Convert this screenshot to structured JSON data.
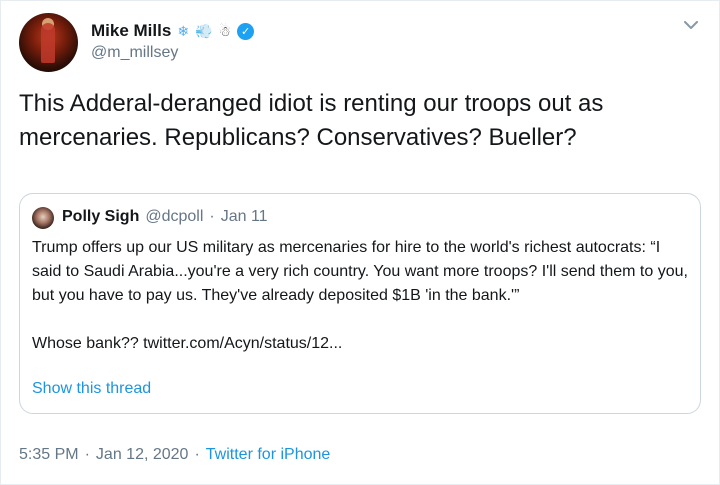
{
  "author": {
    "name": "Mike Mills",
    "name_emojis": [
      "❄",
      "💨",
      "☃"
    ],
    "handle": "@m_millsey"
  },
  "tweet": {
    "text": "This Adderal-deranged idiot is renting our troops out as mercenaries. Republicans? Conservatives? Bueller?"
  },
  "quoted_tweet": {
    "name": "Polly Sigh",
    "handle": "@dcpoll",
    "separator": "·",
    "date": "Jan 11",
    "text": "Trump offers up our US military as mercenaries for hire to the world's richest autocrats: “I said to Saudi Arabia...you're a very rich country. You want more troops? I'll send them to you, but you have to pay us. They've already deposited $1B 'in the bank.'”\n\nWhose bank?? twitter.com/Acyn/status/12...",
    "show_thread": "Show this thread"
  },
  "footer": {
    "time": "5:35 PM",
    "separator": "·",
    "date": "Jan 12, 2020",
    "source": "Twitter for iPhone"
  },
  "colors": {
    "link": "#1b95e0",
    "verified": "#1da1f2",
    "secondary_text": "#657786",
    "border": "#ccd6dd"
  },
  "icons": {
    "verified": "verified-badge-icon",
    "more": "chevron-down-icon"
  }
}
